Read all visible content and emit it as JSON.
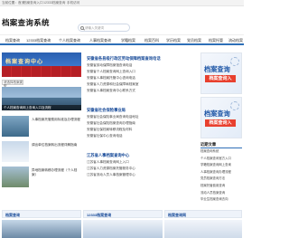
{
  "topbar": {
    "links": [
      "当前位置：首页",
      "档案查询入口",
      "12333档案查询",
      "手机访问"
    ]
  },
  "header": {
    "logo": "档案查询系统",
    "logo_sub": "",
    "search_placeholder": "请输入关键词"
  },
  "nav": {
    "items": [
      "档案查询",
      "12333档案查询",
      "个人档案查询",
      "人事档案查询",
      "学籍档案",
      "档案百科",
      "学历档案",
      "党员档案",
      "档案托管",
      "流动档案"
    ]
  },
  "left": {
    "banner_text": "档案查询中心",
    "select_label": "请选择档案类型",
    "photo_caption": "个人档案查询网上查询入口及流程",
    "thumbs": [
      {
        "text": "人事档案托管费用标准及办理流程"
      },
      {
        "text": "调出单位档案转出流程详解指南"
      },
      {
        "text": "异地档案转移办理流程（个人档案）"
      }
    ]
  },
  "center": {
    "sections": [
      {
        "head": "安徽省各县级行政区劳动保障档案查询电话",
        "items": [
          "安徽省劳动保障档案馆查询电话",
          "安徽省个人档案查询网上查询入口",
          "安徽省人事档案托管中心咨询电话",
          "安徽省人力资源和社会保障局档案室",
          "安徽省人事档案查询中心联系方式"
        ]
      },
      {
        "head": "安徽省社会保险事业局",
        "items": [
          "安徽省社会保险事业局查询电话地址",
          "安徽省社会保险档案查询办理指南",
          "安徽省社保档案转移流程及材料",
          "安徽省社保中心查询电话"
        ]
      },
      {
        "head": "江苏省人事档案查询中心",
        "items": [
          "江苏省人事档案查询网上入口",
          "江苏省人力资源档案托管服务中心",
          "江苏省流动人员人事档案管理中心"
        ]
      }
    ]
  },
  "right": {
    "banner_title": "档案查询",
    "banner_button": "档案查询入",
    "list_head": "近期文章",
    "items": [
      "档案查询系统",
      "个人档案查询官方入口",
      "学籍档案查询网上查询",
      "人事档案查询办理流程",
      "党员档案查询方法",
      "档案托管费用查询",
      "流动人员档案查询",
      "毕业生档案查询去向"
    ]
  },
  "bottom": {
    "bars": [
      "档案查询",
      "12333档案查询",
      "档案查询网"
    ]
  },
  "colors": {
    "accent": "#2e6fb7",
    "brand": "#1b4d9a",
    "alert": "#e8402e"
  }
}
